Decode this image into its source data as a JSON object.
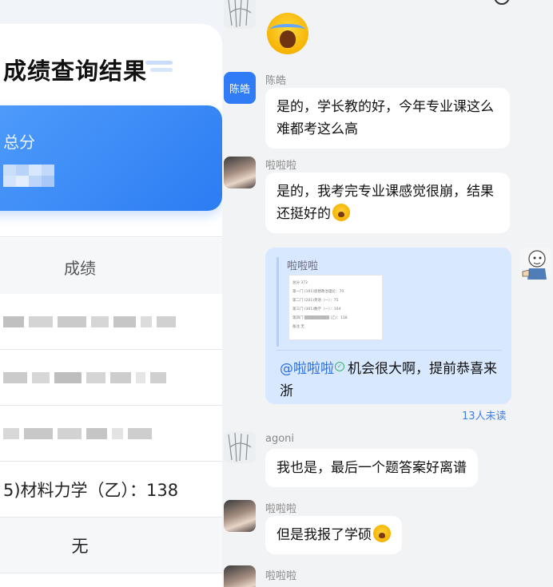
{
  "left": {
    "title": "成绩查询结果",
    "total_label": "总分",
    "column_header": "成绩",
    "subject_row": "5)材料力学（乙）：138",
    "remark_row": "无"
  },
  "chat": {
    "header_title": "",
    "messages": [
      {
        "sender": "陈皓",
        "avatar_text": "陈皓",
        "text": "是的，学长教的好，今年专业课这么难都考这么高"
      },
      {
        "sender": "啦啦啦",
        "text": "是的，我考完专业课感觉很崩，结果还挺好的"
      },
      {
        "quote_sender": "啦啦啦",
        "quote_image_lines": [
          "总分     372",
          "第一门   (101)思想政治理论：70",
          "第二门   (201)英语（一）：75",
          "第三门   (301)数学（一）：104",
          "第四门   ▒▒▒▒▒▒▒▒▒ (乙)：118",
          "备注     无"
        ],
        "mention": "@啦啦啦",
        "text": "机会很大啊，提前恭喜来浙",
        "unread": "13人未读"
      },
      {
        "sender": "agoni",
        "text": "我也是，最后一个题答案好离谱"
      },
      {
        "sender": "啦啦啦",
        "text": "但是我报了学硕"
      },
      {
        "sender": "啦啦啦"
      }
    ]
  },
  "colors": {
    "accent_blue": "#2c7cf3",
    "chat_bg": "#f2f3f5",
    "own_bubble": "#d8e8ff",
    "unread_text": "#3e7fe6"
  }
}
